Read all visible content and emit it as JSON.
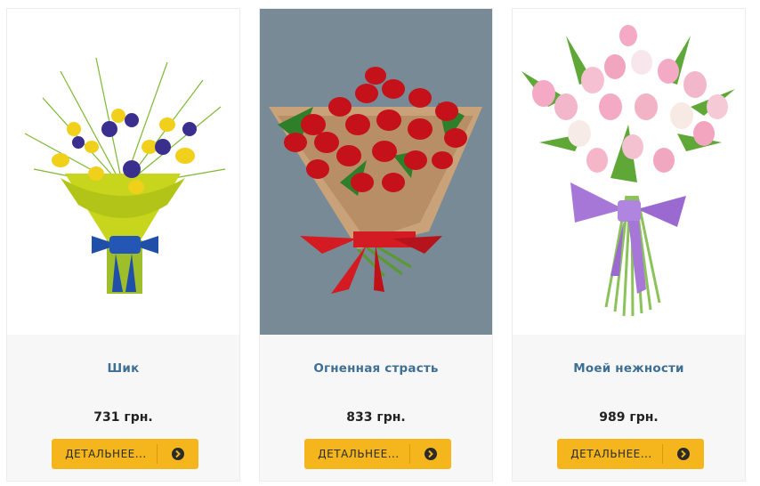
{
  "products": [
    {
      "name": "Шик",
      "price": "731 грн.",
      "button": "ДЕТАЛЬНЕЕ..."
    },
    {
      "name": "Огненная страсть",
      "price": "833 грн.",
      "button": "ДЕТАЛЬНЕЕ..."
    },
    {
      "name": "Моей нежности",
      "price": "989 грн.",
      "button": "ДЕТАЛЬНЕЕ..."
    }
  ],
  "colors": {
    "accent": "#f5b51c",
    "title": "#3e6f94",
    "card_bg": "#f7f7f7",
    "photo_bg_dark": "#778a96"
  },
  "icons": {
    "button_icon": "arrow-circle-right-icon",
    "product_1_image": "yellow-tulips-iris-bouquet",
    "product_2_image": "red-tulips-bouquet",
    "product_3_image": "pink-white-tulips-bouquet"
  }
}
